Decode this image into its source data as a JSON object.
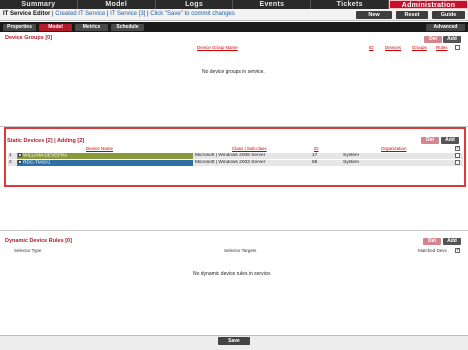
{
  "nav": {
    "tabs": [
      "Summary",
      "Model",
      "Logs",
      "Events",
      "Tickets",
      "Administration"
    ],
    "active": "Administration"
  },
  "editor": {
    "title": "IT Service Editor",
    "created": "Created IT Service",
    "service": "IT Service [3]",
    "note": "Click \"Save\" to commit changes",
    "new_label": "New",
    "reset_label": "Reset",
    "guide_label": "Guide"
  },
  "subtabs": {
    "properties": "Properties",
    "model": "Model",
    "metrics": "Metrics",
    "schedule": "Schedule",
    "advanced": "Advanced"
  },
  "device_groups": {
    "title": "Device Groups [0]",
    "del_label": "Del",
    "add_label": "Add",
    "columns": {
      "name": "Device Group Name",
      "id": "ID",
      "devices": "Devices",
      "groups": "Groups",
      "rules": "Rules"
    },
    "empty_message": "No device groups in service."
  },
  "static_devices": {
    "title": "Static Devices [2] | Adding [2]",
    "del_label": "Del",
    "add_label": "Add",
    "columns": {
      "name": "Device Name",
      "class": "Class | Sub-class",
      "id": "ID",
      "organization": "Organization"
    },
    "rows": [
      {
        "index": "1",
        "name": "WILLIAM-DEVEPRA",
        "class": "Microsoft | Windows 2008 Server",
        "id": "17",
        "organization": "System"
      },
      {
        "index": "2",
        "name": "RDC-TMS01",
        "class": "Microsoft | Windows 2003 Server",
        "id": "85",
        "organization": "System"
      }
    ],
    "row_colors": [
      "#8a9a3a",
      "#2f6fa6"
    ]
  },
  "dynamic_rules": {
    "title": "Dynamic Device Rules [0]",
    "del_label": "Del",
    "add_label": "Add",
    "columns": {
      "selector_type": "Selector Type",
      "selector_targets": "Selector Targets",
      "matched_devs": "Matched Devs"
    },
    "empty_message": "No dynamic device rules in service."
  },
  "footer": {
    "save_label": "Save"
  },
  "colors": {
    "accent": "#b31b2c",
    "highlight_border": "#d93a3a",
    "link": "#1f5fa8"
  }
}
